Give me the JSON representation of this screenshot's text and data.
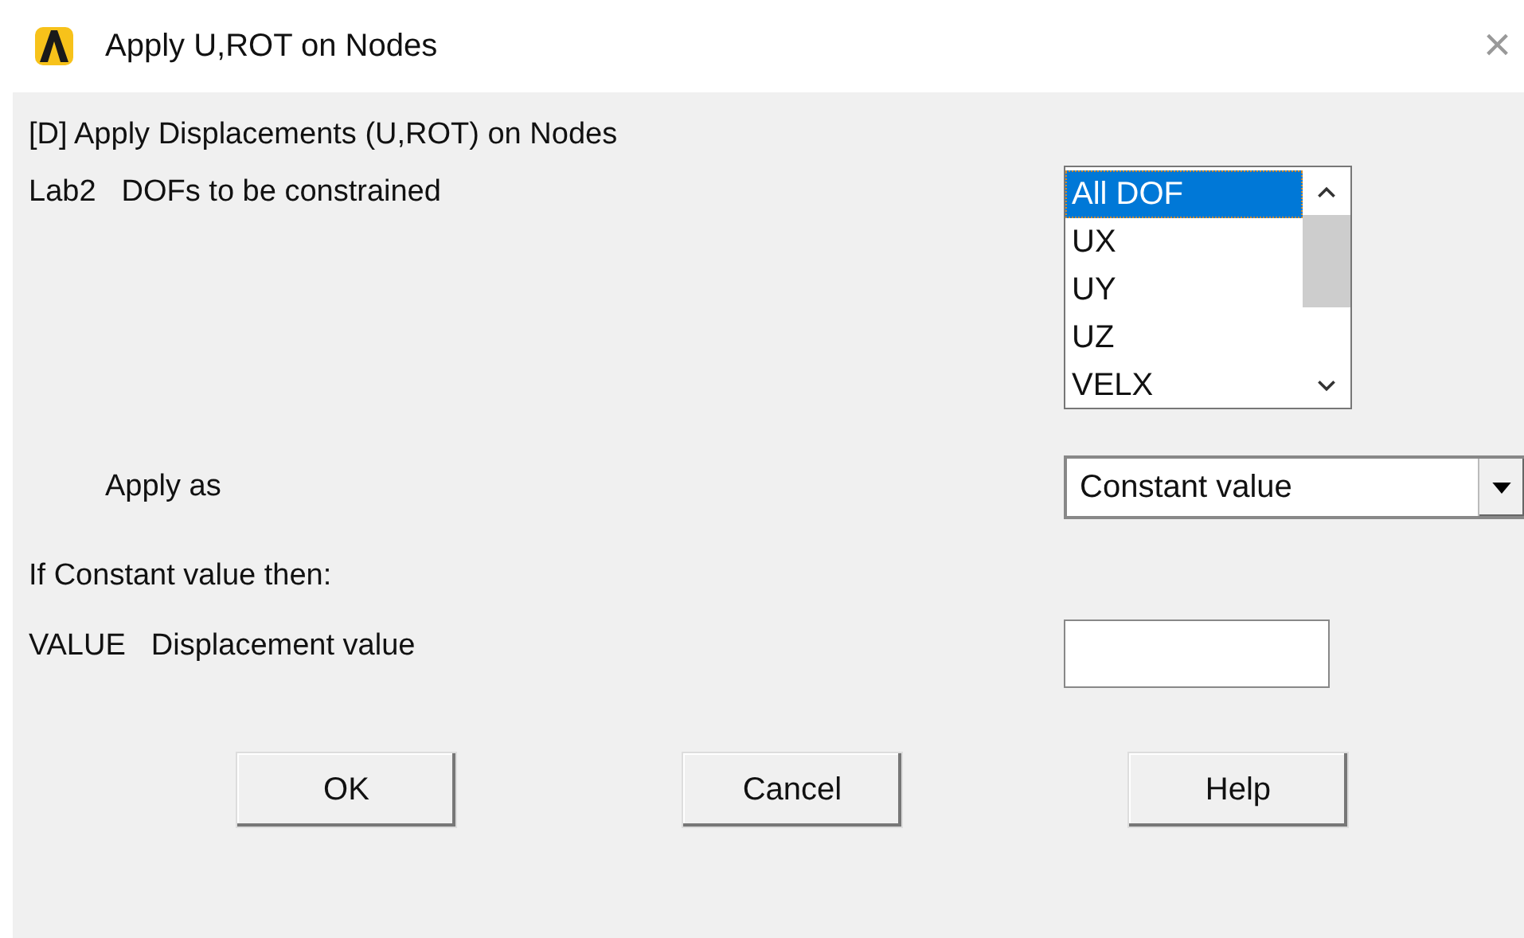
{
  "window": {
    "title": "Apply U,ROT on Nodes",
    "close": "×"
  },
  "heading": "[D]  Apply Displacements (U,ROT) on Nodes",
  "dofs": {
    "code": "Lab2",
    "label": "DOFs to be constrained",
    "items": [
      {
        "label": "All DOF",
        "selected": true
      },
      {
        "label": "UX",
        "selected": false
      },
      {
        "label": "UY",
        "selected": false
      },
      {
        "label": "UZ",
        "selected": false
      },
      {
        "label": "VELX",
        "selected": false
      }
    ]
  },
  "apply_as": {
    "label": "Apply as",
    "value": "Constant value"
  },
  "note": "If Constant value then:",
  "value": {
    "code": "VALUE",
    "label": "Displacement value"
  },
  "buttons": [
    "OK",
    "Cancel",
    "Help"
  ]
}
